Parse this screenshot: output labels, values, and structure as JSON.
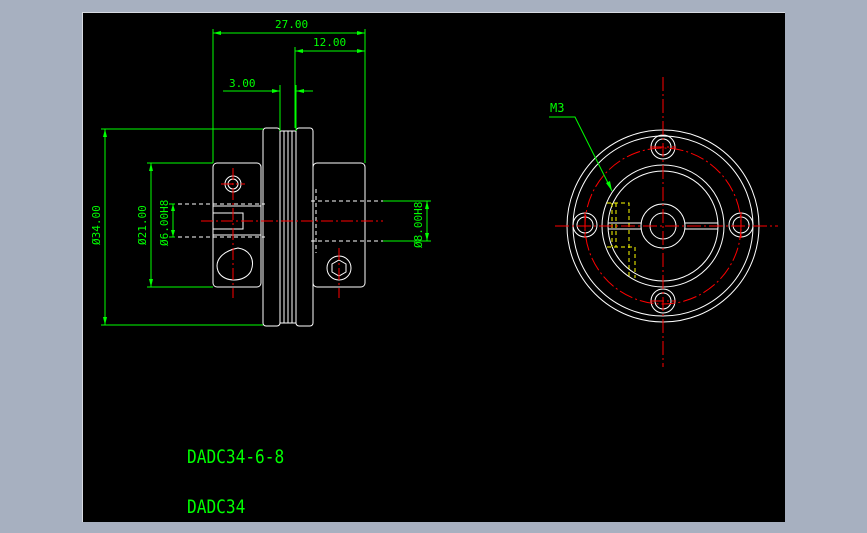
{
  "drawing": {
    "title": "DADC34-6-8",
    "subtitle": "DADC34",
    "dimensions": {
      "overall_length": "27.00",
      "hub_length": "12.00",
      "gap": "3.00",
      "outer_diameter": "Ø34.00",
      "hub_diameter": "Ø21.00",
      "bore_left": "Ø6.00H8",
      "bore_right": "Ø8.00H8"
    },
    "thread_label": "M3"
  },
  "colors": {
    "background": "#000000",
    "frame": "#a7b0c0",
    "geometry": "#ffffff",
    "dimension": "#00ff00",
    "centerline": "#ff0000",
    "hidden": "#ffff00"
  }
}
